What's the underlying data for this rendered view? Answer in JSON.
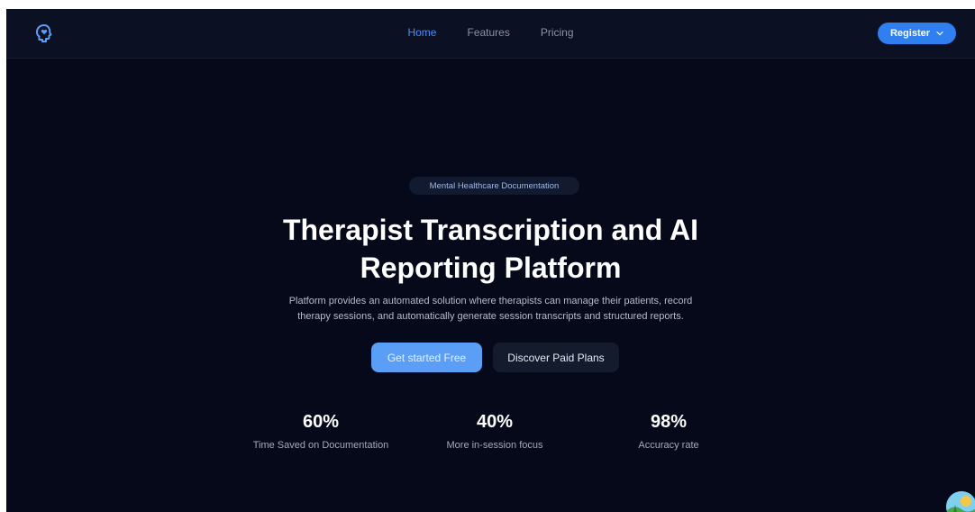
{
  "nav": {
    "logo_icon": "brain-heart-icon",
    "links": [
      {
        "label": "Home",
        "active": true
      },
      {
        "label": "Features",
        "active": false
      },
      {
        "label": "Pricing",
        "active": false
      }
    ],
    "register_label": "Register",
    "accent_color": "#2f7ff0"
  },
  "hero": {
    "badge": "Mental Healthcare Documentation",
    "title_line1": "Therapist Transcription and AI",
    "title_line2": "Reporting Platform",
    "subtitle_line1": "Platform provides an automated solution where therapists can manage their patients, record",
    "subtitle_line2": "therapy sessions, and automatically generate session transcripts and structured reports.",
    "primary_cta": "Get started Free",
    "secondary_cta": "Discover Paid Plans"
  },
  "stats": [
    {
      "value": "60%",
      "label": "Time Saved on Documentation"
    },
    {
      "value": "40%",
      "label": "More in-session focus"
    },
    {
      "value": "98%",
      "label": "Accuracy rate"
    }
  ],
  "background_color": "#05091a"
}
